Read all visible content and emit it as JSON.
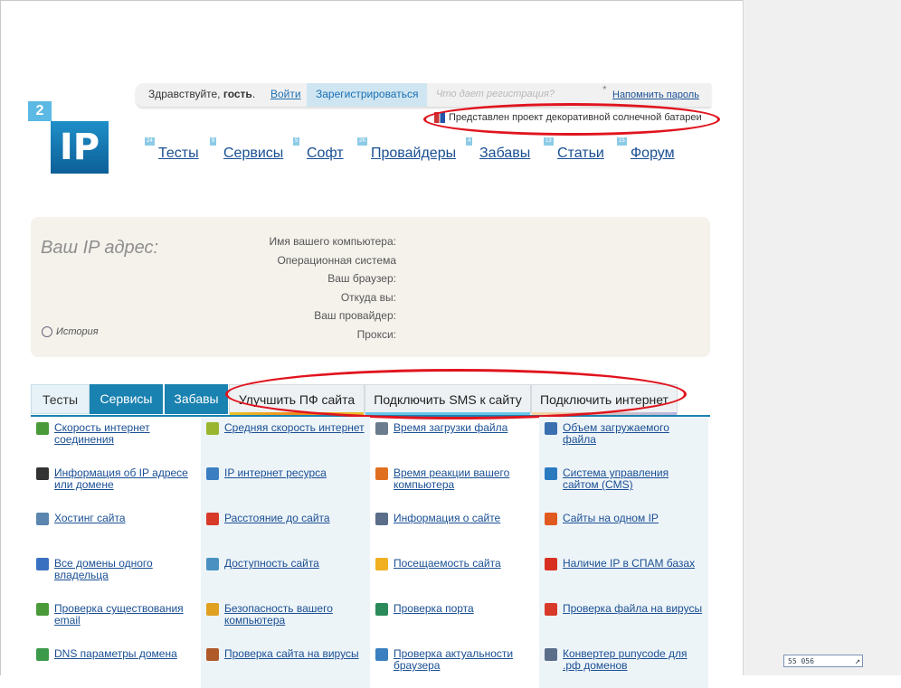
{
  "login_bar": {
    "greeting": "Здравствуйте, ",
    "guest": "гость",
    "dot": ".",
    "login": "Войти",
    "register": "Зарегистрироваться",
    "why_register": "Что дает регистрация?",
    "star": "*",
    "remind_password": "Напомнить пароль"
  },
  "promo": "Представлен проект декоративной солнечной батареи",
  "logo": {
    "two": "2",
    "ip": "IP"
  },
  "nav": [
    {
      "badge": "24",
      "label": "Тесты"
    },
    {
      "badge": "9",
      "label": "Сервисы"
    },
    {
      "badge": "5",
      "label": "Софт"
    },
    {
      "badge": "2K",
      "label": "Провайдеры"
    },
    {
      "badge": "4",
      "label": "Забавы"
    },
    {
      "badge": "13",
      "label": "Статьи"
    },
    {
      "badge": "15",
      "label": "Форум"
    }
  ],
  "ip_panel": {
    "title": "Ваш IP адрес:",
    "labels": [
      "Имя вашего компьютера:",
      "Операционная система",
      "Ваш браузер:",
      "Откуда вы:",
      "Ваш провайдер:",
      "Прокси:"
    ],
    "history": "История"
  },
  "tabs": [
    {
      "label": "Тесты"
    },
    {
      "label": "Сервисы"
    },
    {
      "label": "Забавы"
    },
    {
      "label": "Улучшить ПФ сайта"
    },
    {
      "label": "Подключить SMS к сайту"
    },
    {
      "label": "Подключить интернет"
    }
  ],
  "services": [
    [
      "Скорость интернет соединения",
      "Средняя скорость интернет",
      "Время загрузки файла",
      "Объем загружаемого файла"
    ],
    [
      "Информация об IP адресе или домене",
      "IP интернет ресурса",
      "Время реакции вашего компьютера",
      "Система управления сайтом (CMS)"
    ],
    [
      "Хостинг сайта",
      "Расстояние до сайта",
      "Информация о сайте",
      "Сайты на одном IP"
    ],
    [
      "Все домены одного владельца",
      "Доступность сайта",
      "Посещаемость сайта",
      "Наличие IP в СПАМ базах"
    ],
    [
      "Проверка существования email",
      "Безопасность вашего компьютера",
      "Проверка порта",
      "Проверка файла на вирусы"
    ],
    [
      "DNS параметры домена",
      "Проверка сайта на вирусы",
      "Проверка актуальности браузера",
      "Конвертер punycode для .рф доменов"
    ]
  ],
  "counter": "55 056",
  "colors": {
    "accent": "#1a82b0",
    "link": "#1a4f93",
    "annotation_red": "#e0141e",
    "panel_bg": "#f5f2ec"
  }
}
